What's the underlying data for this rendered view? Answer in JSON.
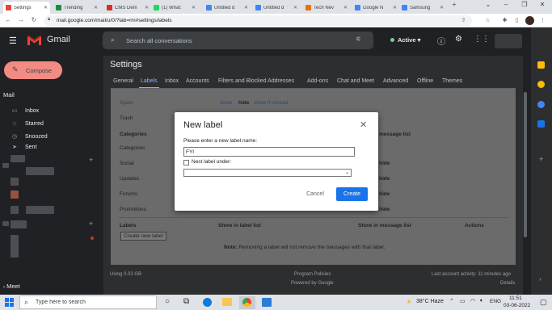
{
  "browser": {
    "tabs": [
      {
        "label": "Settings",
        "color": "#ea4335",
        "active": true
      },
      {
        "label": "Trending",
        "color": "#1e8e3e"
      },
      {
        "label": "CMS Dem",
        "color": "#d93025"
      },
      {
        "label": "(1) What:",
        "color": "#25d366"
      },
      {
        "label": "Untitled d",
        "color": "#4285f4"
      },
      {
        "label": "Untitled d",
        "color": "#4285f4"
      },
      {
        "label": "Tech Nev",
        "color": "#e8710a"
      },
      {
        "label": "Google N",
        "color": "#4285f4"
      },
      {
        "label": "Samsung",
        "color": "#4285f4"
      }
    ],
    "url": "mail.google.com/mail/u/0/?tab=rm#settings/labels"
  },
  "gmail": {
    "logo_text": "Gmail",
    "search_placeholder": "Search all conversations",
    "status": "Active",
    "compose": "Compose"
  },
  "nav": {
    "section_mail": "Mail",
    "items": [
      "Inbox",
      "Starred",
      "Snoozed",
      "Sent"
    ],
    "section_meet": "Meet"
  },
  "settings": {
    "title": "Settings",
    "tabs": [
      "General",
      "Labels",
      "Inbox",
      "Accounts",
      "Filters and Blocked Addresses",
      "Add-ons",
      "Chat and Meet",
      "Advanced",
      "Offline",
      "Themes"
    ],
    "rows": {
      "spam": "Spam",
      "spam_show": "show",
      "spam_hide": "hide",
      "spam_unread": "show if unread",
      "trash": "Trash",
      "categories_header": "Categories",
      "categories": "Categories",
      "social": "Social",
      "updates": "Updates",
      "forums": "Forums",
      "promotions": "Promotions",
      "hide": "hide",
      "message_list_partial": "message list",
      "labels_header": "Labels",
      "show_in_label_list": "Show in label list",
      "show_in_message_list": "Show in message list",
      "actions": "Actions",
      "create_new_label": "Create new label",
      "note_bold": "Note:",
      "note_text": "Removing a label will not remove the messages with that label."
    },
    "footer": {
      "usage": "Using 0.03 GB",
      "policies": "Program Policies",
      "powered": "Powered by Google",
      "activity": "Last account activity: 11 minutes ago",
      "details": "Details"
    }
  },
  "modal": {
    "title": "New label",
    "prompt": "Please enter a new label name:",
    "input_value": "FYI",
    "nest_label": "Nest label under:",
    "cancel": "Cancel",
    "create": "Create"
  },
  "taskbar": {
    "search_placeholder": "Type here to search",
    "weather": "38°C  Haze",
    "lang": "ENG",
    "time": "11:51",
    "date": "03-06-2022"
  }
}
